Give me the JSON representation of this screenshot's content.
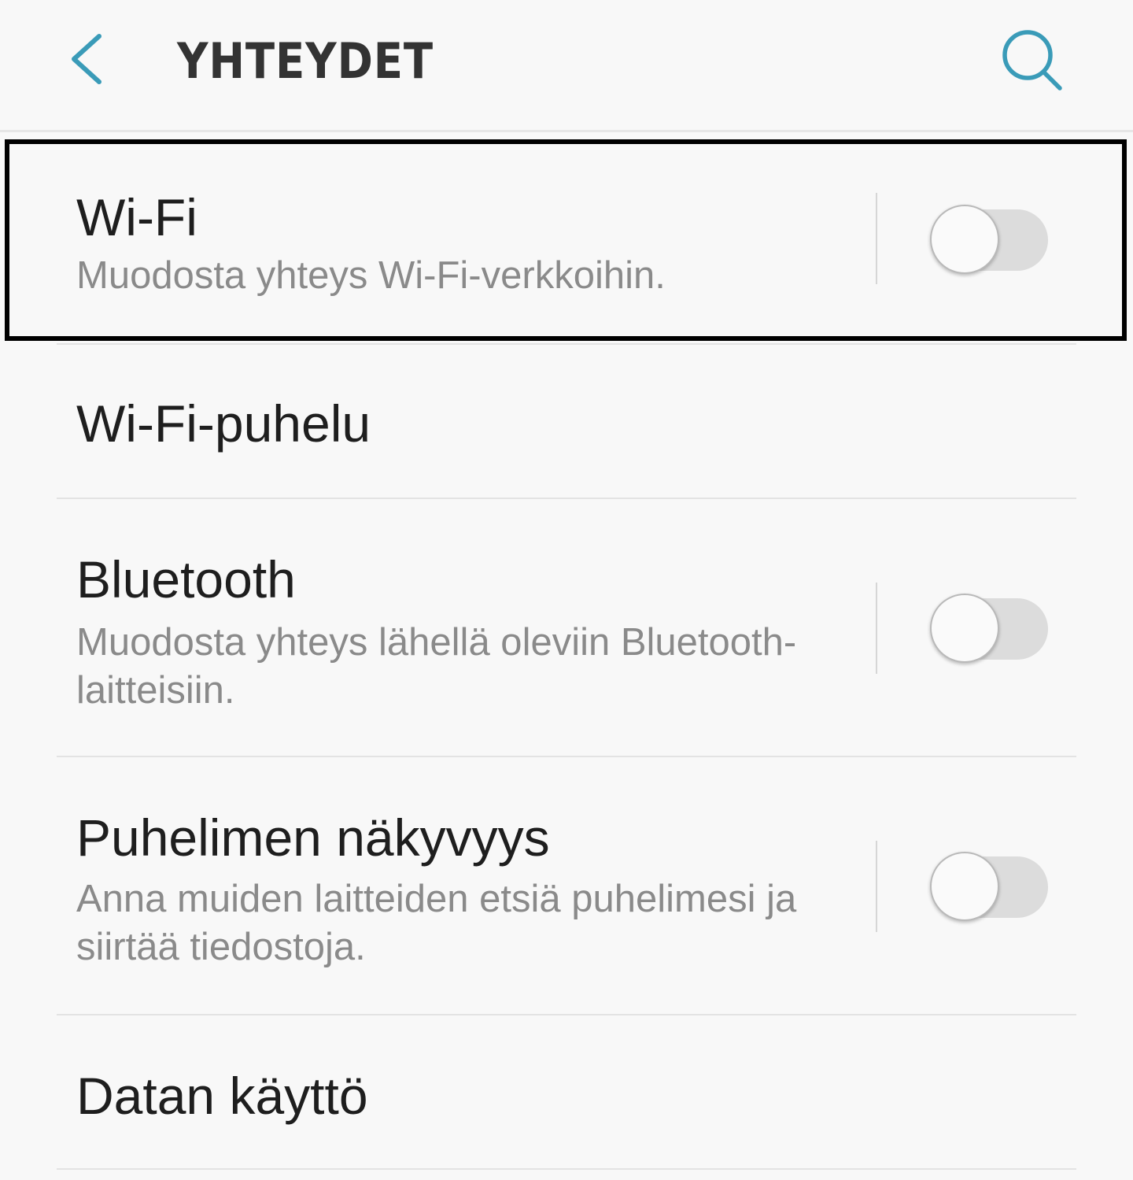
{
  "header": {
    "title": "YHTEYDET",
    "back_icon": "chevron-left-icon",
    "search_icon": "search-icon",
    "accent_color": "#3a9bb8"
  },
  "items": [
    {
      "title": "Wi-Fi",
      "subtitle": "Muodosta yhteys Wi-Fi-verkkoihin.",
      "has_toggle": true,
      "toggle_on": false,
      "highlighted": true
    },
    {
      "title": "Wi-Fi-puhelu",
      "has_toggle": false
    },
    {
      "title": "Bluetooth",
      "subtitle": "Muodosta yhteys lähellä oleviin Bluetooth-laitteisiin.",
      "has_toggle": true,
      "toggle_on": false
    },
    {
      "title": "Puhelimen näkyvyys",
      "subtitle": "Anna muiden laitteiden etsiä puhelimesi ja siirtää tiedostoja.",
      "has_toggle": true,
      "toggle_on": false
    },
    {
      "title": "Datan käyttö",
      "has_toggle": false
    }
  ]
}
